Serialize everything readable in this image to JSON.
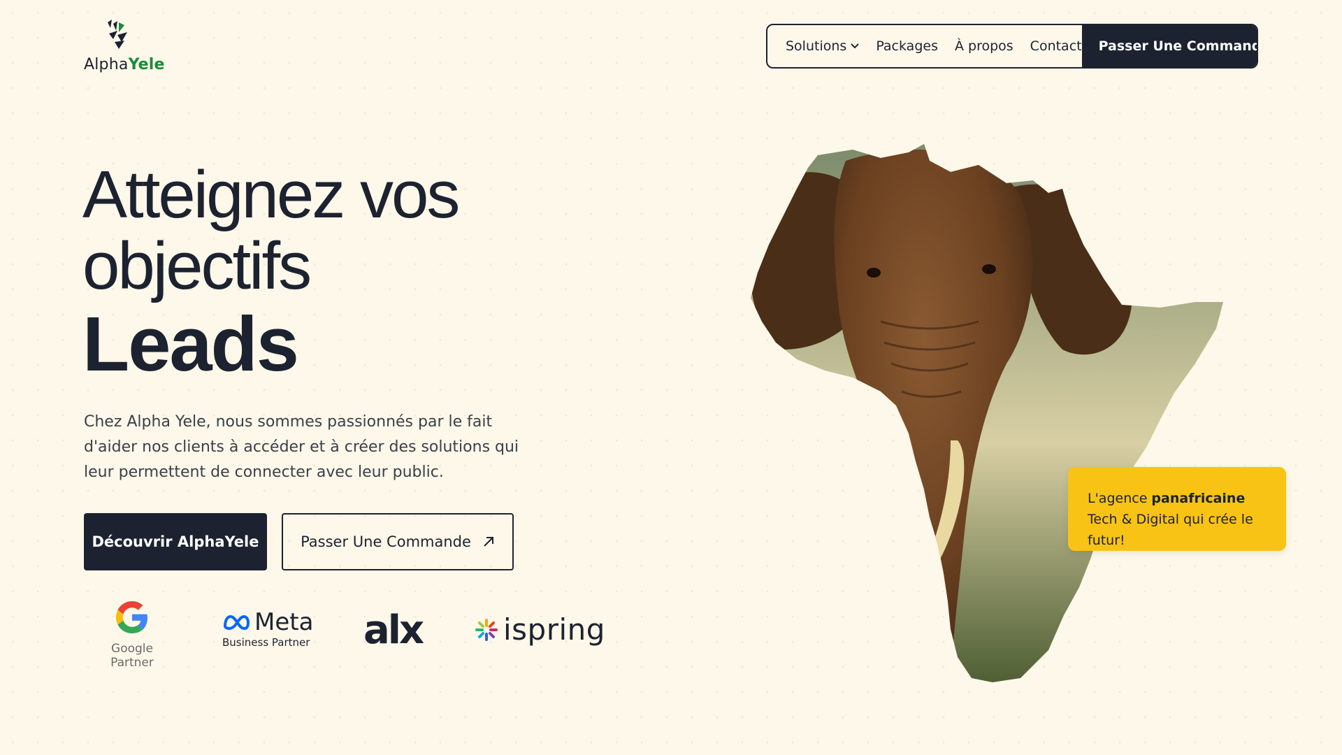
{
  "brand": {
    "name_part1": "Alpha",
    "name_part2": "Yele",
    "accent_color": "#1c8a3a",
    "dark_color": "#1c2230",
    "highlight_color": "#f9c315"
  },
  "nav": {
    "items": [
      {
        "label": "Solutions",
        "has_dropdown": true
      },
      {
        "label": "Packages"
      },
      {
        "label": "À propos"
      },
      {
        "label": "Contact"
      }
    ],
    "cta_label": "Passer Une Commande"
  },
  "hero": {
    "title_line1": "Atteignez vos",
    "title_line2": "objectifs",
    "accent_word": "Leads",
    "description": "Chez Alpha Yele, nous sommes passionnés par le fait d'aider nos clients à accéder et à créer des solutions qui leur permettent de connecter avec leur public.",
    "primary_button": "Découvrir AlphaYele",
    "secondary_button": "Passer Une Commande"
  },
  "partners": {
    "google_caption": "Google Partner",
    "meta_word": "Meta",
    "meta_caption": "Business Partner",
    "alx_word": "alx",
    "ispring_word": "ispring"
  },
  "tag": {
    "prefix": "L'agence ",
    "bold": "panafricaine",
    "suffix": " Tech & Digital qui crée le futur!"
  }
}
